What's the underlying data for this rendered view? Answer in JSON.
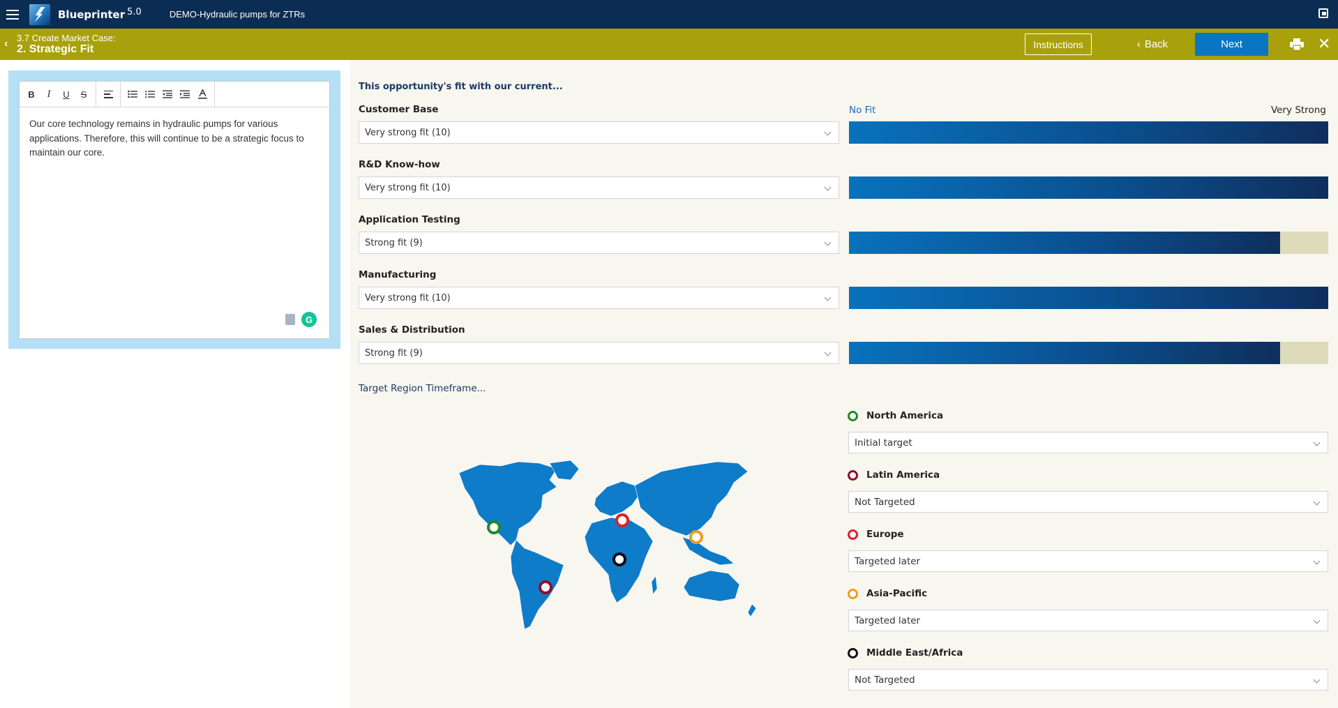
{
  "app": {
    "name": "Blueprinter",
    "version": "5.0",
    "project": "DEMO-Hydraulic pumps for ZTRs"
  },
  "nav": {
    "section": "3.7 Create Market Case:",
    "step": "2. Strategic Fit",
    "instructions_label": "Instructions",
    "back_label": "Back",
    "next_label": "Next"
  },
  "editor": {
    "toolbar": [
      "B",
      "I",
      "U",
      "S"
    ],
    "text": "Our core technology remains in hydraulic pumps for various applications. Therefore, this will continue to be a strategic focus to maintain our core."
  },
  "fit": {
    "heading": "This opportunity's fit with our current...",
    "scale_low": "No Fit",
    "scale_high": "Very Strong",
    "scale_max": 10,
    "criteria": [
      {
        "label": "Customer Base",
        "value": "Very strong fit (10)",
        "score": 10
      },
      {
        "label": "R&D Know-how",
        "value": "Very strong fit (10)",
        "score": 10
      },
      {
        "label": "Application Testing",
        "value": "Strong fit (9)",
        "score": 9
      },
      {
        "label": "Manufacturing",
        "value": "Very strong fit (10)",
        "score": 10
      },
      {
        "label": "Sales & Distribution",
        "value": "Strong fit (9)",
        "score": 9
      }
    ]
  },
  "regions": {
    "heading": "Target Region Timeframe...",
    "items": [
      {
        "label": "North America",
        "value": "Initial target",
        "color": "#1f8a2a"
      },
      {
        "label": "Latin America",
        "value": "Not Targeted",
        "color": "#8e1030"
      },
      {
        "label": "Europe",
        "value": "Targeted later",
        "color": "#e0202a"
      },
      {
        "label": "Asia-Pacific",
        "value": "Targeted later",
        "color": "#f39a1e"
      },
      {
        "label": "Middle East/Africa",
        "value": "Not Targeted",
        "color": "#111111"
      }
    ]
  },
  "colors": {
    "topbar": "#0c2d53",
    "subbar": "#a8a10c",
    "accent": "#0a75c2",
    "map": "#0e7cc8"
  }
}
